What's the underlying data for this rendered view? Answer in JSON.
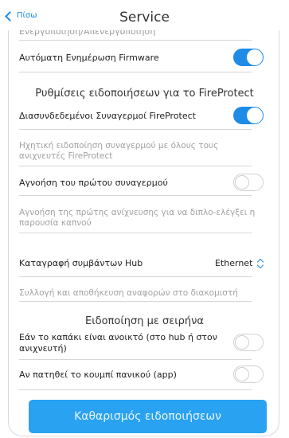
{
  "header": {
    "back_label": "Πίσω",
    "title": "Service"
  },
  "clipped_text": "Ενεργοποίηση/Απενεργοποίηση",
  "rows": {
    "firmware": {
      "label": "Αυτόματη Ενημέρωση Firmware",
      "on": true
    },
    "linked_alarms": {
      "label": "Διασυνδεδεμένοι Συναγερμοί FireProtect",
      "on": true
    },
    "ignore_first": {
      "label": "Αγνοήση του πρώτου συναγερμού",
      "on": false
    },
    "hub_events": {
      "label": "Καταγραφή συμβάντων Hub",
      "value": "Ethernet"
    },
    "lid_open": {
      "label": "Εάν το καπάκι είναι ανοικτό (στο hub ή στον ανιχνευτή)",
      "on": false
    },
    "panic_button": {
      "label": "Αν πατηθεί το κουμπί πανικού (app)",
      "on": false
    }
  },
  "sections": {
    "fireprotect": "Ρυθμίσεις ειδοποιήσεων για το FireProtect",
    "siren": "Ειδοποίηση με σειρήνα"
  },
  "hints": {
    "linked_alarms": "Ηχητική ειδοποίηση συναγερμού με όλους τους ανιχνευτές FireProtect",
    "ignore_first": "Αγνοήση της πρώτης ανίχνευσης για να διπλο-ελέγξει η παρουσία καπνού",
    "hub_events": "Συλλογή και αποθήκευση αναφορών στο διακομιστή"
  },
  "button": {
    "clear_label": "Καθαρισμός ειδοποιήσεων"
  },
  "colors": {
    "accent": "#1e8be6",
    "button": "#29a2f2"
  }
}
